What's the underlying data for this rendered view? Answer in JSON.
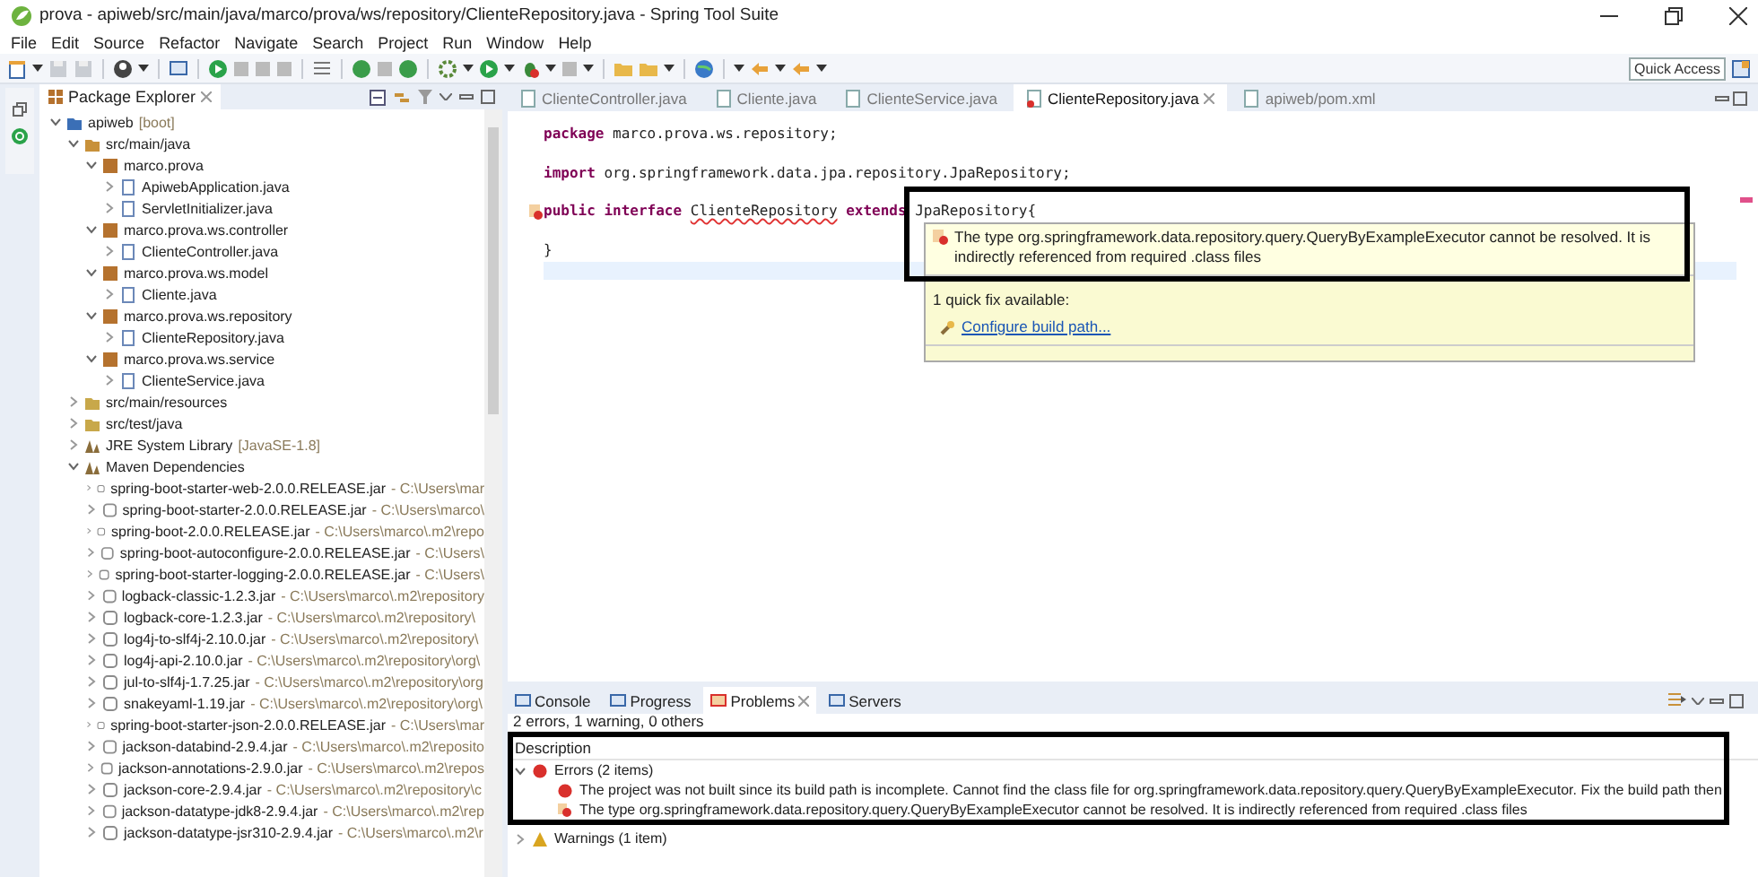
{
  "window": {
    "title": "prova - apiweb/src/main/java/marco/prova/ws/repository/ClienteRepository.java - Spring Tool Suite"
  },
  "menu": [
    "File",
    "Edit",
    "Source",
    "Refactor",
    "Navigate",
    "Search",
    "Project",
    "Run",
    "Window",
    "Help"
  ],
  "toolbar": {
    "quick_access": {
      "placeholder": "Quick Access"
    }
  },
  "explorer": {
    "title": "Package Explorer",
    "tree": [
      {
        "kind": "project",
        "label": "apiweb",
        "decoration": "[boot]",
        "expanded": true,
        "children": [
          {
            "kind": "source-folder",
            "label": "src/main/java",
            "expanded": true,
            "children": [
              {
                "kind": "package",
                "label": "marco.prova",
                "expanded": true,
                "children": [
                  {
                    "kind": "java-file",
                    "label": "ApiwebApplication.java",
                    "expanded": false
                  },
                  {
                    "kind": "java-file",
                    "label": "ServletInitializer.java",
                    "expanded": false
                  }
                ]
              },
              {
                "kind": "package",
                "label": "marco.prova.ws.controller",
                "expanded": true,
                "children": [
                  {
                    "kind": "java-file",
                    "label": "ClienteController.java",
                    "expanded": false
                  }
                ]
              },
              {
                "kind": "package",
                "label": "marco.prova.ws.model",
                "expanded": true,
                "children": [
                  {
                    "kind": "java-file",
                    "label": "Cliente.java",
                    "expanded": false
                  }
                ]
              },
              {
                "kind": "package",
                "label": "marco.prova.ws.repository",
                "expanded": true,
                "children": [
                  {
                    "kind": "java-file",
                    "label": "ClienteRepository.java",
                    "expanded": false
                  }
                ]
              },
              {
                "kind": "package",
                "label": "marco.prova.ws.service",
                "expanded": true,
                "children": [
                  {
                    "kind": "java-file",
                    "label": "ClienteService.java",
                    "expanded": false
                  }
                ]
              }
            ]
          },
          {
            "kind": "folder",
            "label": "src/main/resources",
            "expanded": false
          },
          {
            "kind": "folder",
            "label": "src/test/java",
            "expanded": false
          },
          {
            "kind": "library",
            "label": "JRE System Library",
            "decoration": "[JavaSE-1.8]",
            "expanded": false
          },
          {
            "kind": "library",
            "label": "Maven Dependencies",
            "expanded": true,
            "children": [
              {
                "kind": "jar",
                "label": "spring-boot-starter-web-2.0.0.RELEASE.jar",
                "decoration": "- C:\\Users\\mar",
                "expanded": false
              },
              {
                "kind": "jar",
                "label": "spring-boot-starter-2.0.0.RELEASE.jar",
                "decoration": "- C:\\Users\\marco\\",
                "expanded": false
              },
              {
                "kind": "jar",
                "label": "spring-boot-2.0.0.RELEASE.jar",
                "decoration": "- C:\\Users\\marco\\.m2\\repo",
                "expanded": false
              },
              {
                "kind": "jar",
                "label": "spring-boot-autoconfigure-2.0.0.RELEASE.jar",
                "decoration": "- C:\\Users\\",
                "expanded": false
              },
              {
                "kind": "jar",
                "label": "spring-boot-starter-logging-2.0.0.RELEASE.jar",
                "decoration": "- C:\\Users\\",
                "expanded": false
              },
              {
                "kind": "jar",
                "label": "logback-classic-1.2.3.jar",
                "decoration": "- C:\\Users\\marco\\.m2\\repository",
                "expanded": false
              },
              {
                "kind": "jar",
                "label": "logback-core-1.2.3.jar",
                "decoration": "- C:\\Users\\marco\\.m2\\repository\\",
                "expanded": false
              },
              {
                "kind": "jar",
                "label": "log4j-to-slf4j-2.10.0.jar",
                "decoration": "- C:\\Users\\marco\\.m2\\repository\\",
                "expanded": false
              },
              {
                "kind": "jar",
                "label": "log4j-api-2.10.0.jar",
                "decoration": "- C:\\Users\\marco\\.m2\\repository\\org\\",
                "expanded": false
              },
              {
                "kind": "jar",
                "label": "jul-to-slf4j-1.7.25.jar",
                "decoration": "- C:\\Users\\marco\\.m2\\repository\\org",
                "expanded": false
              },
              {
                "kind": "jar",
                "label": "snakeyaml-1.19.jar",
                "decoration": "- C:\\Users\\marco\\.m2\\repository\\org\\",
                "expanded": false
              },
              {
                "kind": "jar",
                "label": "spring-boot-starter-json-2.0.0.RELEASE.jar",
                "decoration": "- C:\\Users\\mar",
                "expanded": false
              },
              {
                "kind": "jar",
                "label": "jackson-databind-2.9.4.jar",
                "decoration": "- C:\\Users\\marco\\.m2\\reposito",
                "expanded": false
              },
              {
                "kind": "jar",
                "label": "jackson-annotations-2.9.0.jar",
                "decoration": "- C:\\Users\\marco\\.m2\\repos",
                "expanded": false
              },
              {
                "kind": "jar",
                "label": "jackson-core-2.9.4.jar",
                "decoration": "- C:\\Users\\marco\\.m2\\repository\\c",
                "expanded": false
              },
              {
                "kind": "jar",
                "label": "jackson-datatype-jdk8-2.9.4.jar",
                "decoration": "- C:\\Users\\marco\\.m2\\rep",
                "expanded": false
              },
              {
                "kind": "jar",
                "label": "jackson-datatype-jsr310-2.9.4.jar",
                "decoration": "- C:\\Users\\marco\\.m2\\r",
                "expanded": false
              }
            ]
          }
        ]
      }
    ]
  },
  "editor": {
    "tabs": [
      {
        "label": "ClienteController.java",
        "selected": false
      },
      {
        "label": "Cliente.java",
        "selected": false
      },
      {
        "label": "ClienteService.java",
        "selected": false
      },
      {
        "label": "ClienteRepository.java",
        "selected": true,
        "error": true
      },
      {
        "label": "apiweb/pom.xml",
        "selected": false
      }
    ],
    "lines": [
      {
        "tokens": [
          {
            "kind": "keyword",
            "text": "package"
          },
          {
            "kind": "plain",
            "text": "marco.prova.ws.repository;",
            "spaced": true
          }
        ]
      },
      {
        "blank": true
      },
      {
        "tokens": [
          {
            "kind": "keyword",
            "text": "import"
          },
          {
            "kind": "plain",
            "text": "org.springframework.data.jpa.repository.JpaRepository;",
            "spaced": true
          }
        ]
      },
      {
        "blank": true
      },
      {
        "error_marker": true,
        "tokens": [
          {
            "kind": "keyword",
            "text": "public interface"
          },
          {
            "kind": "error",
            "text": "ClienteRepository",
            "spaced": true
          },
          {
            "kind": "keyword",
            "text": "extends",
            "spaced": true
          },
          {
            "kind": "plain",
            "text": "JpaRepository{",
            "spaced": true
          }
        ]
      },
      {
        "blank": true
      },
      {
        "tokens": [
          {
            "kind": "plain",
            "text": "}"
          }
        ]
      },
      {
        "blank": true,
        "current": true
      }
    ],
    "hover": {
      "message": "The type org.springframework.data.repository.query.QueryByExampleExecutor cannot be resolved. It is indirectly referenced from required .class files",
      "fixes_title": "1 quick fix available:",
      "fixes": [
        "Configure build path..."
      ]
    }
  },
  "bottom": {
    "tabs": [
      {
        "label": "Console",
        "selected": false
      },
      {
        "label": "Progress",
        "selected": false
      },
      {
        "label": "Problems",
        "selected": true
      },
      {
        "label": "Servers",
        "selected": false
      }
    ],
    "summary": "2 errors, 1 warning, 0 others",
    "column": "Description",
    "groups": [
      {
        "kind": "error",
        "label": "Errors (2 items)",
        "expanded": true,
        "children": [
          {
            "kind": "error",
            "text": "The project was not built since its build path is incomplete. Cannot find the class file for org.springframework.data.repository.query.QueryByExampleExecutor. Fix the build path then"
          },
          {
            "kind": "type-error",
            "text": "The type org.springframework.data.repository.query.QueryByExampleExecutor cannot be resolved. It is indirectly referenced from required .class files"
          }
        ]
      },
      {
        "kind": "warning",
        "label": "Warnings (1 item)",
        "expanded": false
      }
    ]
  }
}
